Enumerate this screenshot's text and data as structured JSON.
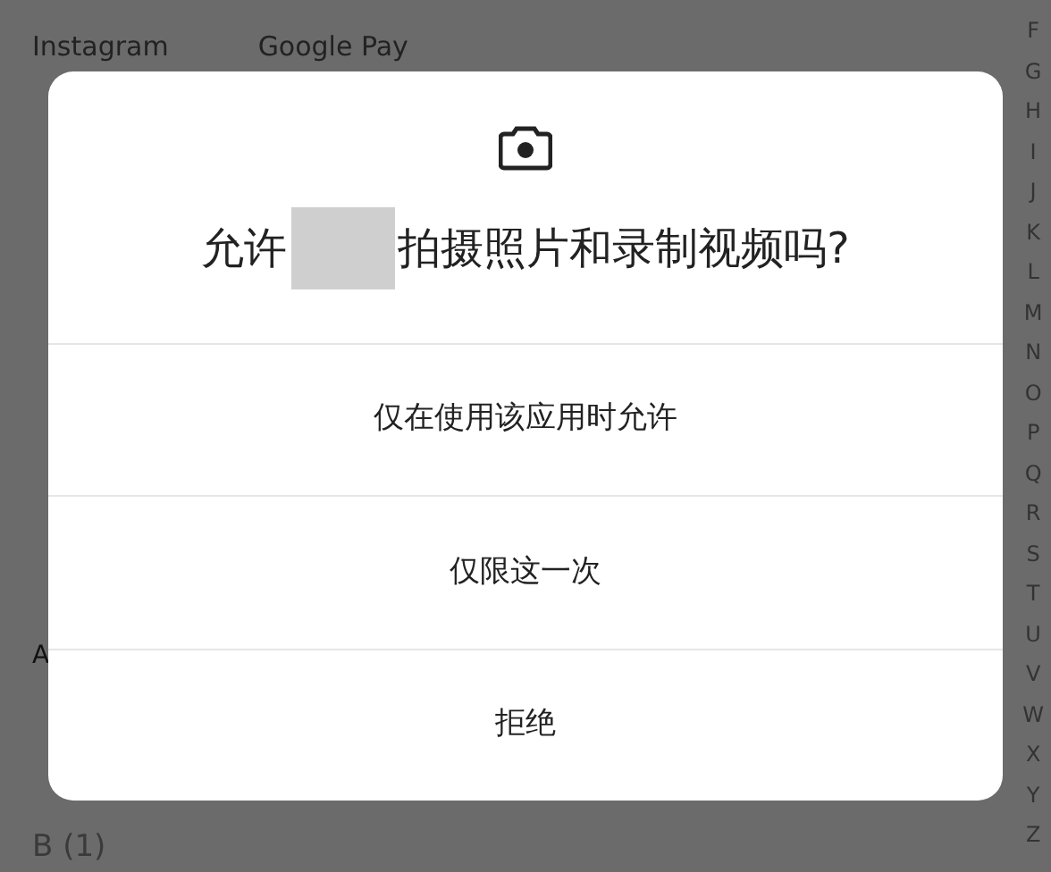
{
  "background": {
    "apps": [
      "Instagram",
      "Google Pay"
    ],
    "section_label": "A",
    "section_header": "B (1)",
    "index_letters": [
      "F",
      "G",
      "H",
      "I",
      "J",
      "K",
      "L",
      "M",
      "N",
      "O",
      "P",
      "Q",
      "R",
      "S",
      "T",
      "U",
      "V",
      "W",
      "X",
      "Y",
      "Z"
    ]
  },
  "dialog": {
    "title_before": "允许",
    "title_after": "拍摄照片和录制视频吗?",
    "options": [
      "仅在使用该应用时允许",
      "仅限这一次",
      "拒绝"
    ]
  }
}
